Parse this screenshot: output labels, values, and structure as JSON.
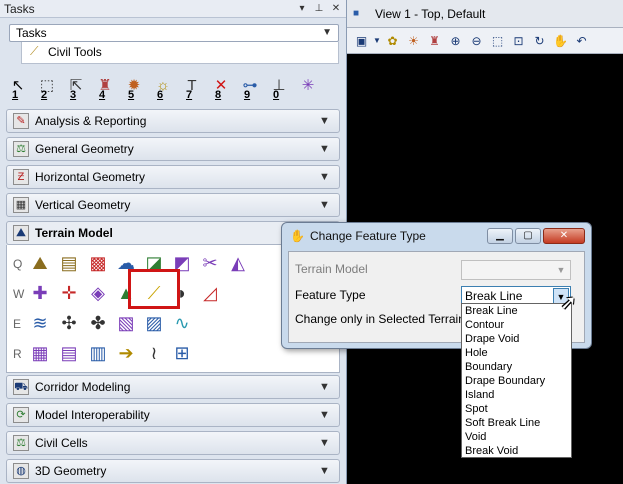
{
  "tasks_panel": {
    "title": "Tasks",
    "title_buttons": [
      "▾",
      "⊥",
      "✕"
    ],
    "dropdown_value": "Tasks",
    "active_tab": "Civil Tools",
    "toolbar_numbers": [
      "1",
      "2",
      "3",
      "4",
      "5",
      "6",
      "7",
      "8",
      "9",
      "0"
    ],
    "sections_top": [
      {
        "label": "Analysis & Reporting",
        "icon": "analysis-icon"
      },
      {
        "label": "General Geometry",
        "icon": "general-geometry-icon"
      },
      {
        "label": "Horizontal Geometry",
        "icon": "horizontal-geometry-icon"
      },
      {
        "label": "Vertical Geometry",
        "icon": "vertical-geometry-icon"
      }
    ],
    "terrain_section": {
      "label": "Terrain Model",
      "row_letters": [
        "Q",
        "W",
        "E",
        "R"
      ]
    },
    "sections_bottom": [
      {
        "label": "Corridor Modeling",
        "icon": "corridor-icon"
      },
      {
        "label": "Model Interoperability",
        "icon": "interoperability-icon"
      },
      {
        "label": "Civil Cells",
        "icon": "civil-cells-icon"
      },
      {
        "label": "3D Geometry",
        "icon": "3d-geometry-icon"
      }
    ]
  },
  "view_window": {
    "title": "View 1 - Top, Default",
    "background_color": "#000000"
  },
  "dialog": {
    "title": "Change Feature Type",
    "fields": {
      "terrain_model_label": "Terrain Model",
      "feature_type_label": "Feature Type",
      "feature_type_value": "Break Line",
      "selected_terrain_label": "Change only in Selected Terrain"
    },
    "feature_type_options": [
      "Break Line",
      "Contour",
      "Drape Void",
      "Hole",
      "Boundary",
      "Drape Boundary",
      "Island",
      "Spot",
      "Soft Break Line",
      "Void",
      "Break Void"
    ]
  },
  "colors": {
    "highlight": "#d01515",
    "dialog_frame": "#c9daec",
    "panel_bg": "#dde4ee"
  }
}
